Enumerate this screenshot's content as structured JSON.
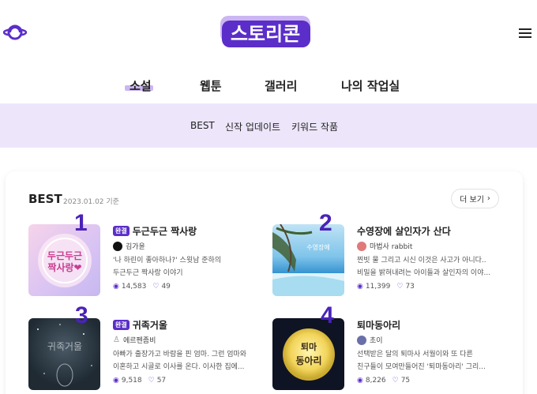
{
  "header": {
    "logo_text": "스토리콘",
    "planet_icon": "planet-icon",
    "menu_icon": "hamburger-icon"
  },
  "nav": {
    "items": [
      {
        "label": "소설",
        "active": true
      },
      {
        "label": "웹툰"
      },
      {
        "label": "갤러리"
      },
      {
        "label": "나의 작업실"
      }
    ]
  },
  "subnav": {
    "items": [
      {
        "label": "BEST"
      },
      {
        "label": "신작 업데이트"
      },
      {
        "label": "키워드 작품"
      }
    ]
  },
  "best": {
    "title": "BEST",
    "date": "2023.01.02 기준",
    "more_label": "더 보기",
    "items": [
      {
        "rank": "1",
        "badge": "완결",
        "title": "두근두근 짝사랑",
        "author": "김가윤",
        "desc": "'나 하린이 좋아하나?' 스윗남 준하의\n두근두근 짝사랑 이야기",
        "views": "14,583",
        "likes": "49",
        "cover_text": "두근두근 짝사랑❤"
      },
      {
        "rank": "2",
        "badge": "",
        "title": "수영장에 살인자가 산다",
        "author": "마법사 rabbit",
        "desc": "찐빗 물 그리고 시신 이것은 사고가 아니다..\n비밀을 밝혀내려는 아이들과 살인자의 이야...",
        "views": "11,399",
        "likes": "73",
        "cover_text": ""
      },
      {
        "rank": "3",
        "badge": "완결",
        "title": "귀족거울",
        "author": "에르펜좀비",
        "desc": "아빠가 출장가고 바람을 핀 엄마. 그런 엄마와\n이혼하고 시골로 이사를 온다. 이사한 집에...",
        "views": "9,518",
        "likes": "57",
        "cover_text": "귀족거울"
      },
      {
        "rank": "4",
        "badge": "",
        "title": "퇴마동아리",
        "author": "초이",
        "desc": "선택받은 달의 퇴마사 서월이와 또 다른\n친구들이 모여만들어진 '퇴마동아리' 그리...",
        "views": "8,226",
        "likes": "75",
        "cover_text_1": "퇴마",
        "cover_text_2": "동아리"
      }
    ]
  },
  "colors": {
    "accent": "#5b2ec9",
    "subbar": "#ede6fb"
  }
}
